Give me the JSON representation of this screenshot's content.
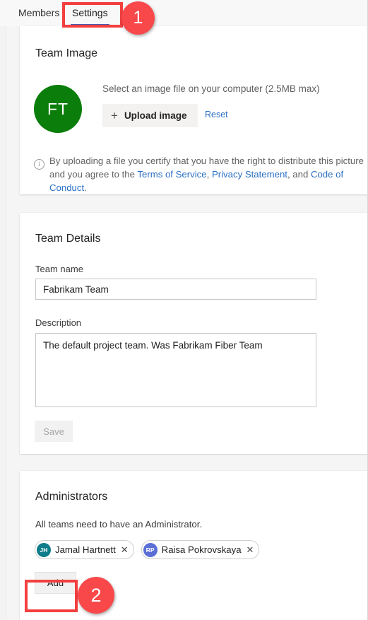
{
  "tabs": [
    {
      "id": "members",
      "label": "Members",
      "active": false
    },
    {
      "id": "settings",
      "label": "Settings",
      "active": true
    }
  ],
  "team_image": {
    "title": "Team Image",
    "avatar_initials": "FT",
    "avatar_color": "#0a7d0a",
    "hint": "Select an image file on your computer (2.5MB max)",
    "upload_button_label": "Upload image",
    "plus_icon": "plus-icon",
    "reset_label": "Reset",
    "info_icon": "info-icon",
    "legal": {
      "lead": "By uploading a file you certify that you have the right to distribute this picture and you agree to the ",
      "link_terms": "Terms of Service",
      "sep1": ", ",
      "link_privacy": "Privacy Statement",
      "sep2": ", and ",
      "link_conduct": "Code of Conduct",
      "tail": "."
    }
  },
  "team_details": {
    "title": "Team Details",
    "team_name_label": "Team name",
    "team_name_value": "Fabrikam Team",
    "team_name_placeholder": "Team name",
    "description_label": "Description",
    "description_value": "The default project team. Was Fabrikam Fiber Team",
    "description_placeholder": "Description",
    "save_label": "Save"
  },
  "administrators": {
    "title": "Administrators",
    "note": "All teams need to have an Administrator.",
    "chips": [
      {
        "initials": "JH",
        "name": "Jamal Hartnett",
        "color": "#0f7c8a",
        "remove_icon": "close-icon"
      },
      {
        "initials": "RP",
        "name": "Raisa Pokrovskaya",
        "color": "#5b6fd6",
        "remove_icon": "close-icon"
      }
    ],
    "add_label": "Add"
  },
  "annotations": [
    {
      "id": "1",
      "label": "1",
      "target": "settings-tab",
      "color": "#f8484a"
    },
    {
      "id": "2",
      "label": "2",
      "target": "add-button",
      "color": "#f8484a"
    }
  ]
}
